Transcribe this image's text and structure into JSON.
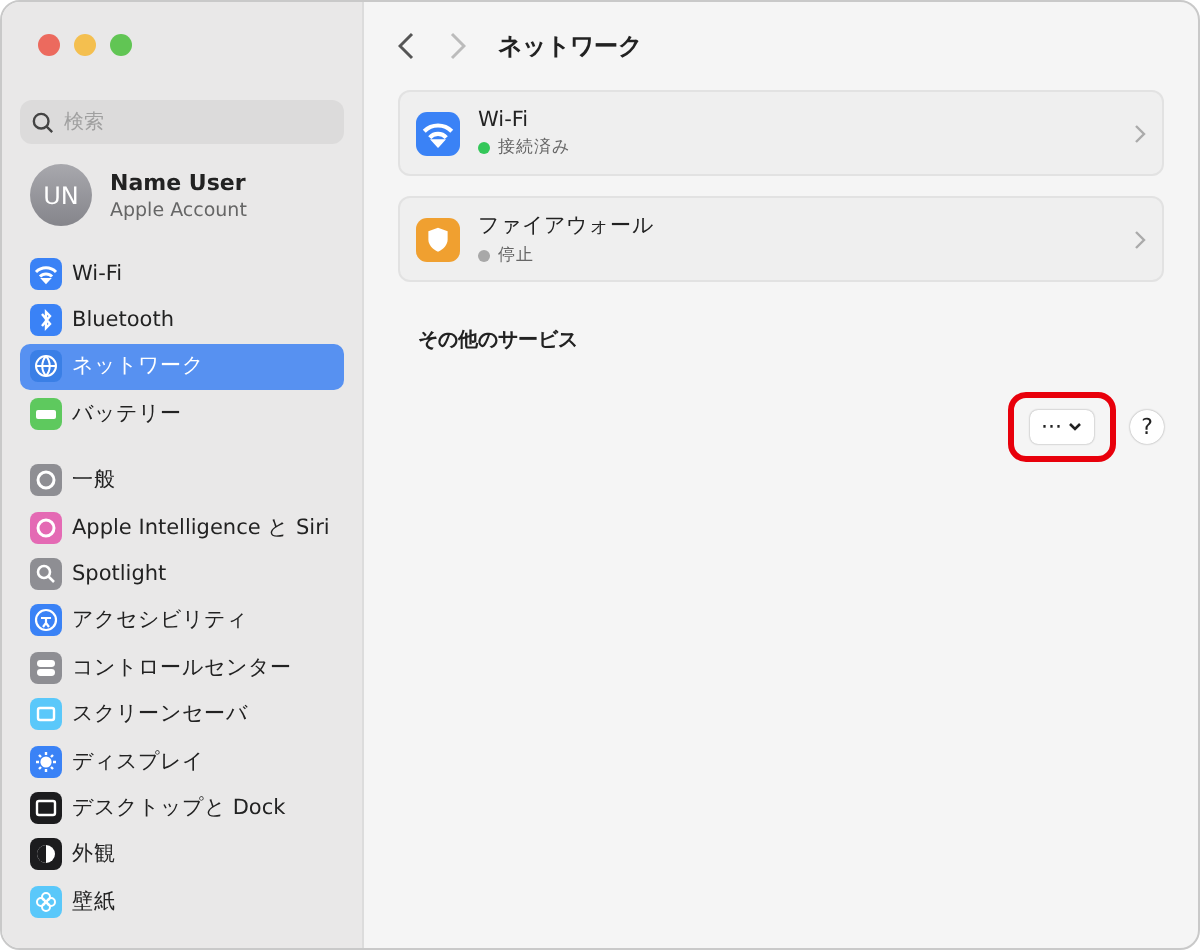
{
  "window": {
    "title": "ネットワーク"
  },
  "sidebar": {
    "search": {
      "placeholder": "検索"
    },
    "account": {
      "initials": "UN",
      "name": "Name User",
      "subtitle": "Apple Account"
    },
    "sections": [
      {
        "items": [
          {
            "label": "Wi-Fi",
            "selected": false
          },
          {
            "label": "Bluetooth",
            "selected": false
          },
          {
            "label": "ネットワーク",
            "selected": true
          },
          {
            "label": "バッテリー",
            "selected": false
          }
        ]
      },
      {
        "items": [
          {
            "label": "一般",
            "selected": false
          },
          {
            "label": "Apple Intelligence と Siri",
            "selected": false
          },
          {
            "label": "Spotlight",
            "selected": false
          },
          {
            "label": "アクセシビリティ",
            "selected": false
          },
          {
            "label": "コントロールセンター",
            "selected": false
          },
          {
            "label": "スクリーンセーバ",
            "selected": false
          },
          {
            "label": "ディスプレイ",
            "selected": false
          },
          {
            "label": "デスクトップと Dock",
            "selected": false
          },
          {
            "label": "外観",
            "selected": false
          },
          {
            "label": "壁紙",
            "selected": false
          }
        ]
      }
    ]
  },
  "services": [
    {
      "name": "Wi-Fi",
      "status": "接続済み",
      "color": "#34c759"
    },
    {
      "name": "ファイアウォール",
      "status": "停止",
      "color": "#a8a8a8"
    }
  ],
  "other_services": {
    "heading": "その他のサービス"
  },
  "more_button": {
    "label": "···",
    "highlighted": true
  },
  "help_button": {
    "label": "?"
  }
}
